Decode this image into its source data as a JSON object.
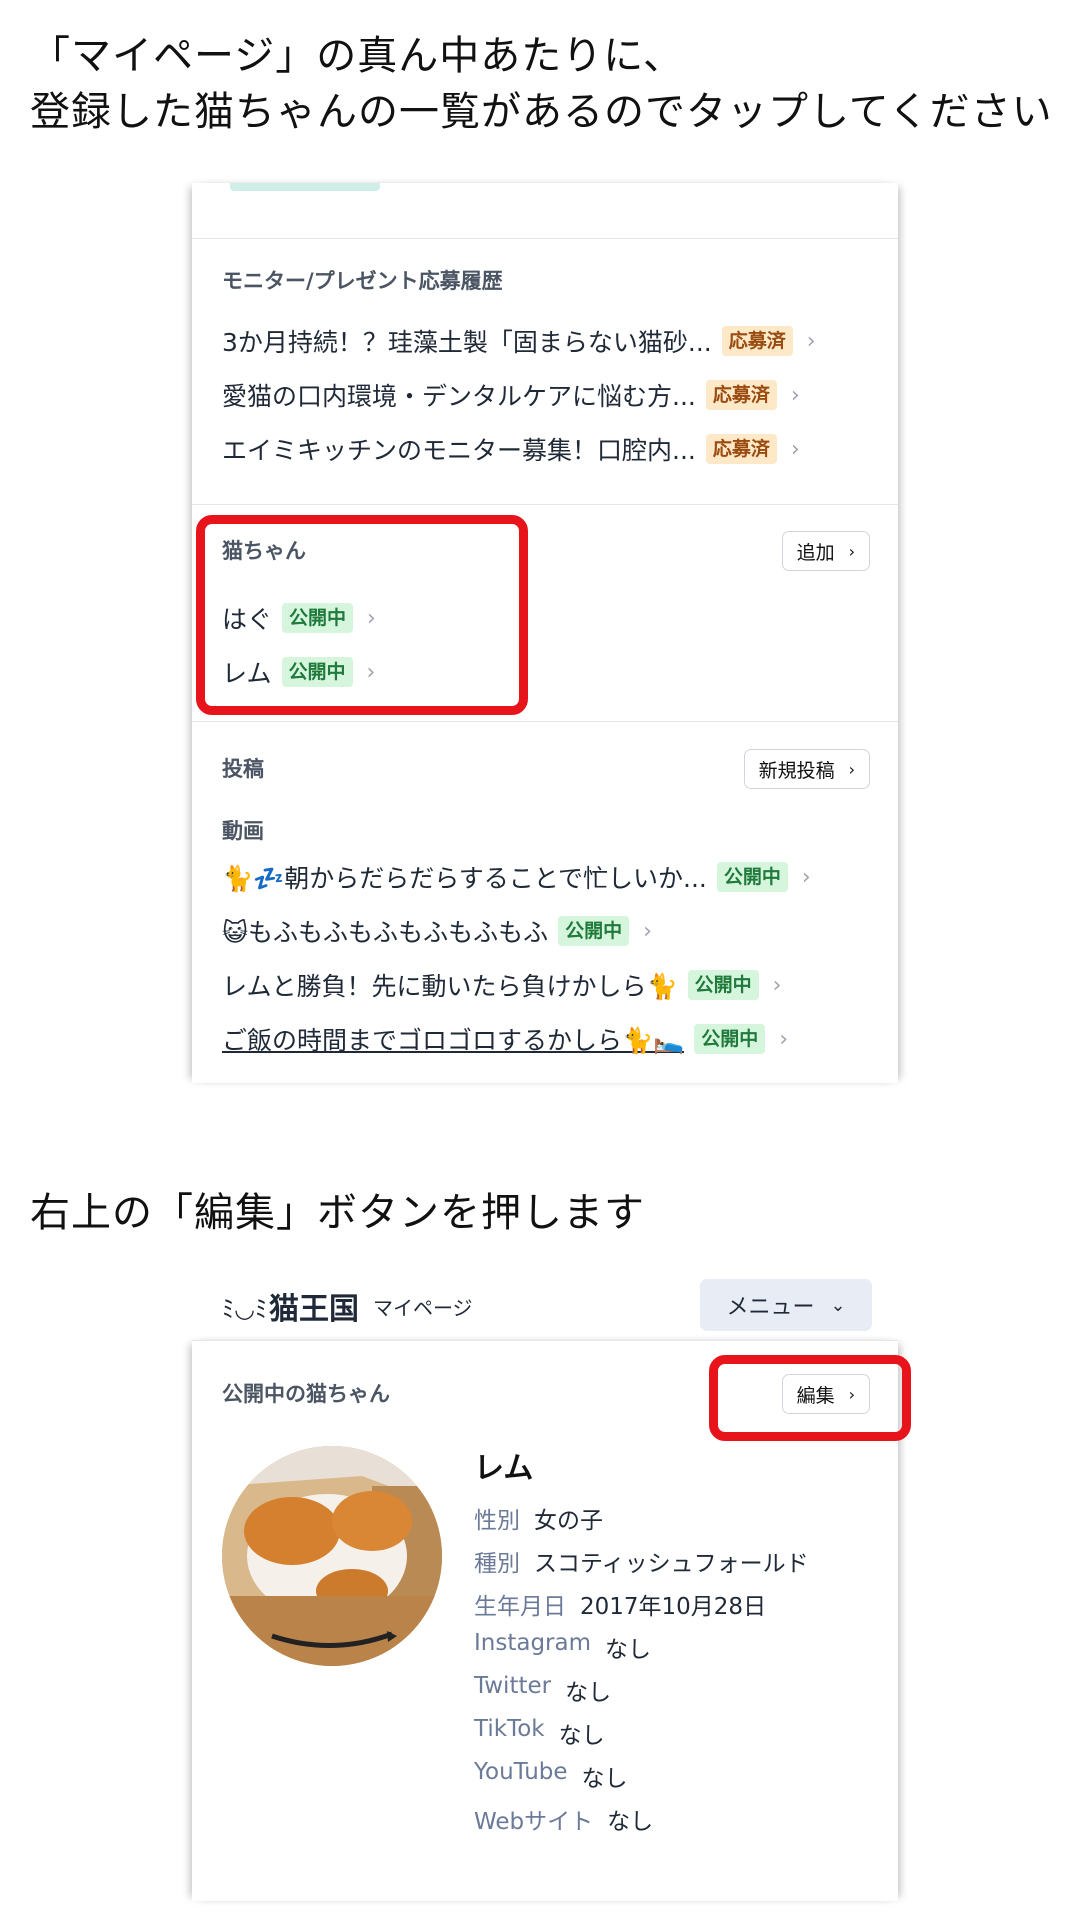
{
  "instructions": {
    "step1_line1": "「マイページ」の真ん中あたりに、",
    "step1_line2": "登録した猫ちゃんの一覧があるのでタップしてください",
    "step2": "右上の「編集」ボタンを押します"
  },
  "screen1": {
    "applications": {
      "title": "モニター/プレゼント応募履歴",
      "items": [
        {
          "text": "3か月持続！？珪藻土製「固まらない猫砂...",
          "badge": "応募済"
        },
        {
          "text": "愛猫の口内環境・デンタルケアに悩む方...",
          "badge": "応募済"
        },
        {
          "text": "エイミキッチンのモニター募集！口腔内...",
          "badge": "応募済"
        }
      ]
    },
    "cats": {
      "title": "猫ちゃん",
      "add_label": "追加",
      "items": [
        {
          "name": "はぐ",
          "badge": "公開中"
        },
        {
          "name": "レム",
          "badge": "公開中"
        }
      ]
    },
    "posts": {
      "title": "投稿",
      "new_label": "新規投稿",
      "video_label": "動画",
      "items": [
        {
          "text": "🐈💤朝からだらだらすることで忙しいか...",
          "badge": "公開中"
        },
        {
          "text": "😺もふもふもふもふもふもふ",
          "badge": "公開中"
        },
        {
          "text": "レムと勝負！先に動いたら負けかしら🐈",
          "badge": "公開中"
        },
        {
          "text": "ご飯の時間までゴロゴロするかしら🐈🛌",
          "badge": "公開中"
        }
      ]
    },
    "chevron": "›"
  },
  "screen2": {
    "logo": "猫王国",
    "page_label": "マイページ",
    "menu_label": "メニュー",
    "menu_chevron": "⌄",
    "section_title": "公開中の猫ちゃん",
    "edit_label": "編集",
    "cat_name": "レム",
    "fields": [
      {
        "key": "性別",
        "value": "女の子"
      },
      {
        "key": "種別",
        "value": "スコティッシュフォールド"
      },
      {
        "key": "生年月日",
        "value": "2017年10月28日"
      },
      {
        "key": "Instagram",
        "value": "なし"
      },
      {
        "key": "Twitter",
        "value": "なし"
      },
      {
        "key": "TikTok",
        "value": "なし"
      },
      {
        "key": "YouTube",
        "value": "なし"
      },
      {
        "key": "Webサイト",
        "value": "なし"
      }
    ]
  },
  "colors": {
    "highlight_red": "#e8141c",
    "badge_public_bg": "#d6f5dd",
    "badge_applied_bg": "#fde8c8",
    "label_gray_blue": "#6b7a99"
  }
}
